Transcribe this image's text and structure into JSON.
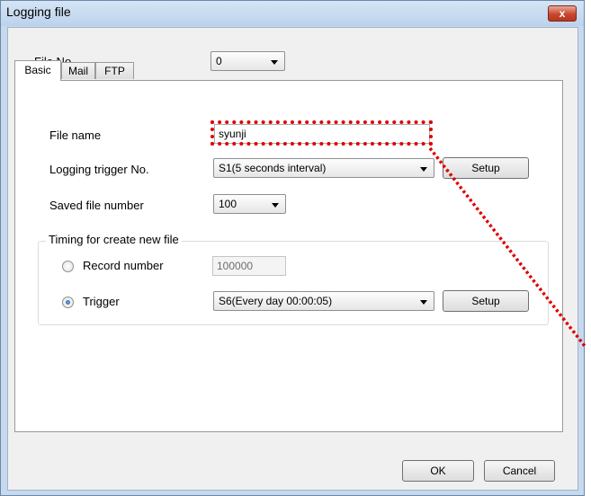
{
  "window": {
    "title": "Logging file",
    "close_label": "x"
  },
  "file_no": {
    "label": "File No.",
    "value": "0"
  },
  "tabs": [
    {
      "label": "Basic",
      "active": true
    },
    {
      "label": "Mail",
      "active": false
    },
    {
      "label": "FTP",
      "active": false
    }
  ],
  "basic": {
    "file_name_label": "File name",
    "file_name_value": "syunji",
    "trigger_label": "Logging trigger No.",
    "trigger_value": "S1(5 seconds interval)",
    "trigger_setup_label": "Setup",
    "saved_number_label": "Saved file number",
    "saved_number_value": "100",
    "timing_group": {
      "title": "Timing for create new file",
      "record_label": "Record number",
      "record_value": "100000",
      "record_selected": false,
      "trigger_label": "Trigger",
      "trigger_value": "S6(Every day 00:00:05)",
      "trigger_selected": true,
      "trigger_setup_label": "Setup"
    }
  },
  "footer": {
    "ok_label": "OK",
    "cancel_label": "Cancel"
  },
  "annotation": {
    "color": "#e00000"
  }
}
